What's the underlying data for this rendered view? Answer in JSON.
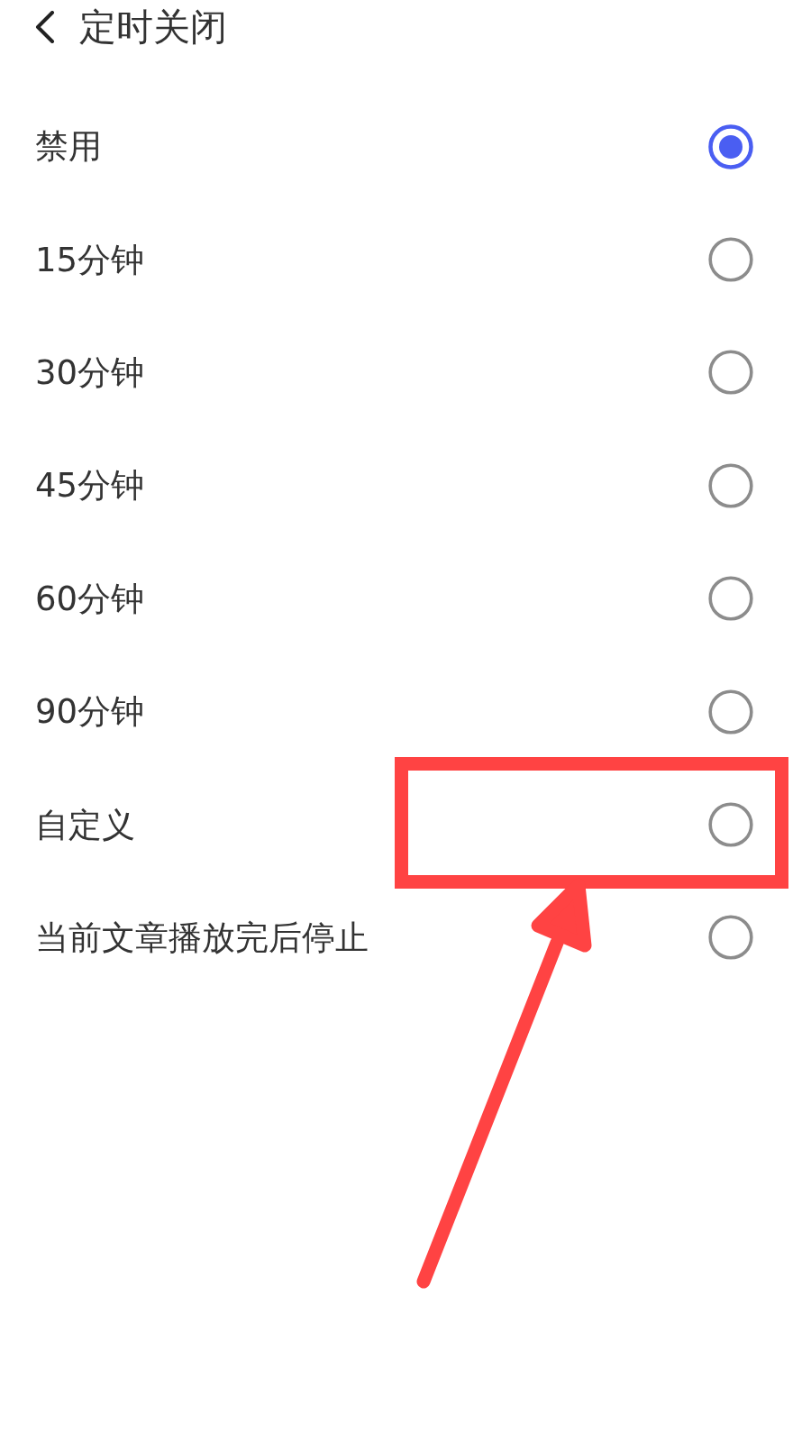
{
  "header": {
    "title": "定时关闭"
  },
  "options": [
    {
      "label": "禁用",
      "selected": true,
      "highlighted": false
    },
    {
      "label": "15分钟",
      "selected": false,
      "highlighted": false
    },
    {
      "label": "30分钟",
      "selected": false,
      "highlighted": false
    },
    {
      "label": "45分钟",
      "selected": false,
      "highlighted": false
    },
    {
      "label": "60分钟",
      "selected": false,
      "highlighted": false
    },
    {
      "label": "90分钟",
      "selected": false,
      "highlighted": false
    },
    {
      "label": "自定义",
      "selected": false,
      "highlighted": true
    },
    {
      "label": "当前文章播放完后停止",
      "selected": false,
      "highlighted": false
    }
  ]
}
